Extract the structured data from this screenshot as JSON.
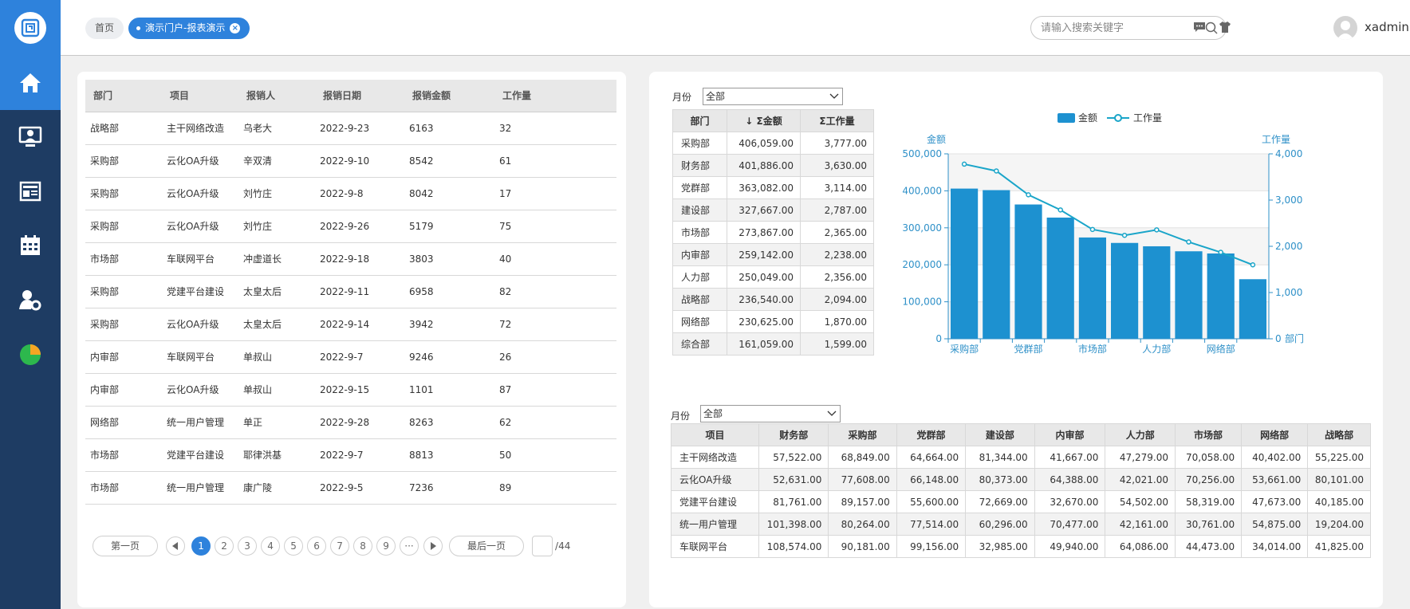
{
  "sidebar": {
    "items": [
      {
        "icon": "home-icon",
        "active": true
      },
      {
        "icon": "monitor-user-icon",
        "active": false
      },
      {
        "icon": "newspaper-icon",
        "active": false
      },
      {
        "icon": "calendar-icon",
        "active": false
      },
      {
        "icon": "user-settings-icon",
        "active": false
      },
      {
        "icon": "pie-chart-icon",
        "active": false
      }
    ]
  },
  "header": {
    "home_label": "首页",
    "tab_label": "演示门户-报表演示",
    "search_placeholder": "请输入搜索关键字",
    "username": "xadmin"
  },
  "left_table": {
    "columns": [
      "部门",
      "项目",
      "报销人",
      "报销日期",
      "报销金额",
      "工作量"
    ],
    "rows": [
      [
        "战略部",
        "主干网络改造",
        "乌老大",
        "2022-9-23",
        "6163",
        "32"
      ],
      [
        "采购部",
        "云化OA升级",
        "辛双清",
        "2022-9-10",
        "8542",
        "61"
      ],
      [
        "采购部",
        "云化OA升级",
        "刘竹庄",
        "2022-9-8",
        "8042",
        "17"
      ],
      [
        "采购部",
        "云化OA升级",
        "刘竹庄",
        "2022-9-26",
        "5179",
        "75"
      ],
      [
        "市场部",
        "车联网平台",
        "冲虚道长",
        "2022-9-18",
        "3803",
        "40"
      ],
      [
        "采购部",
        "党建平台建设",
        "太皇太后",
        "2022-9-11",
        "6958",
        "82"
      ],
      [
        "采购部",
        "云化OA升级",
        "太皇太后",
        "2022-9-14",
        "3942",
        "72"
      ],
      [
        "内审部",
        "车联网平台",
        "单叔山",
        "2022-9-7",
        "9246",
        "26"
      ],
      [
        "内审部",
        "云化OA升级",
        "单叔山",
        "2022-9-15",
        "1101",
        "87"
      ],
      [
        "网络部",
        "统一用户管理",
        "单正",
        "2022-9-28",
        "8263",
        "62"
      ],
      [
        "市场部",
        "党建平台建设",
        "耶律洪基",
        "2022-9-7",
        "8813",
        "50"
      ],
      [
        "市场部",
        "统一用户管理",
        "康广陵",
        "2022-9-5",
        "7236",
        "89"
      ]
    ]
  },
  "pager": {
    "first_label": "第一页",
    "last_label": "最后一页",
    "pages": [
      "1",
      "2",
      "3",
      "4",
      "5",
      "6",
      "7",
      "8",
      "9",
      "···"
    ],
    "current": "1",
    "total": "/44"
  },
  "summary": {
    "month_label": "月份",
    "month_value": "全部",
    "columns": [
      "部门",
      "↓ Σ金额",
      "Σ工作量"
    ],
    "rows": [
      [
        "采购部",
        "406,059.00",
        "3,777.00"
      ],
      [
        "财务部",
        "401,886.00",
        "3,630.00"
      ],
      [
        "党群部",
        "363,082.00",
        "3,114.00"
      ],
      [
        "建设部",
        "327,667.00",
        "2,787.00"
      ],
      [
        "市场部",
        "273,867.00",
        "2,365.00"
      ],
      [
        "内审部",
        "259,142.00",
        "2,238.00"
      ],
      [
        "人力部",
        "250,049.00",
        "2,356.00"
      ],
      [
        "战略部",
        "236,540.00",
        "2,094.00"
      ],
      [
        "网络部",
        "230,625.00",
        "1,870.00"
      ],
      [
        "综合部",
        "161,059.00",
        "1,599.00"
      ]
    ]
  },
  "chart_data": {
    "type": "bar",
    "categories": [
      "采购部",
      "财务部",
      "党群部",
      "建设部",
      "市场部",
      "内审部",
      "人力部",
      "战略部",
      "网络部",
      "综合部"
    ],
    "x_tick_labels": [
      "采购部",
      "党群部",
      "市场部",
      "人力部",
      "网络部"
    ],
    "series": [
      {
        "name": "金额",
        "type": "bar",
        "axis": "left",
        "values": [
          406059,
          401886,
          363082,
          327667,
          273867,
          259142,
          250049,
          236540,
          230625,
          161059
        ]
      },
      {
        "name": "工作量",
        "type": "line",
        "axis": "right",
        "values": [
          3777,
          3630,
          3114,
          2787,
          2365,
          2238,
          2356,
          2094,
          1870,
          1599
        ]
      }
    ],
    "y_left": {
      "label": "金额",
      "min": 0,
      "max": 500000,
      "ticks": [
        "0",
        "100,000",
        "200,000",
        "300,000",
        "400,000",
        "500,000"
      ]
    },
    "y_right": {
      "label": "工作量",
      "min": 0,
      "max": 4000,
      "ticks": [
        "0",
        "1,000",
        "2,000",
        "3,000",
        "4,000"
      ]
    },
    "x_axis_end_label": "部门",
    "legend": "top-center",
    "colors": {
      "bar": "#1d91d0",
      "line": "#1aa5c9"
    }
  },
  "pivot": {
    "month_label": "月份",
    "month_value": "全部",
    "columns": [
      "项目",
      "财务部",
      "采购部",
      "党群部",
      "建设部",
      "内审部",
      "人力部",
      "市场部",
      "网络部",
      "战略部"
    ],
    "rows": [
      [
        "主干网络改造",
        "57,522.00",
        "68,849.00",
        "64,664.00",
        "81,344.00",
        "41,667.00",
        "47,279.00",
        "70,058.00",
        "40,402.00",
        "55,225.00"
      ],
      [
        "云化OA升级",
        "52,631.00",
        "77,608.00",
        "66,148.00",
        "80,373.00",
        "64,388.00",
        "42,021.00",
        "70,256.00",
        "53,661.00",
        "80,101.00"
      ],
      [
        "党建平台建设",
        "81,761.00",
        "89,157.00",
        "55,600.00",
        "72,669.00",
        "32,670.00",
        "54,502.00",
        "58,319.00",
        "47,673.00",
        "40,185.00"
      ],
      [
        "统一用户管理",
        "101,398.00",
        "80,264.00",
        "77,514.00",
        "60,296.00",
        "70,477.00",
        "42,161.00",
        "30,761.00",
        "54,875.00",
        "19,204.00"
      ],
      [
        "车联网平台",
        "108,574.00",
        "90,181.00",
        "99,156.00",
        "32,985.00",
        "49,940.00",
        "64,086.00",
        "44,473.00",
        "34,014.00",
        "41,825.00"
      ]
    ]
  }
}
